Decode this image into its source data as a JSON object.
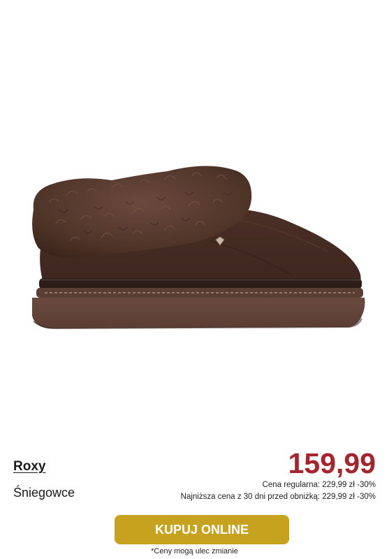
{
  "product": {
    "brand": "Roxy",
    "category": "Śniegowce",
    "price": "159,99",
    "regular_price_note": "Cena regularna: 229,99 zł -30%",
    "lowest_price_note": "Najniższa cena z 30 dni przed obniżką: 229,99 zł -30%",
    "image_icon": "snow-boot-image",
    "colors": {
      "price": "#a3262d",
      "button": "#c7a21f",
      "boot": "#4a2f25"
    }
  },
  "cta": {
    "label": "KUPUJ ONLINE"
  },
  "footer": {
    "disclaimer": "*Ceny mogą ulec zmianie"
  }
}
